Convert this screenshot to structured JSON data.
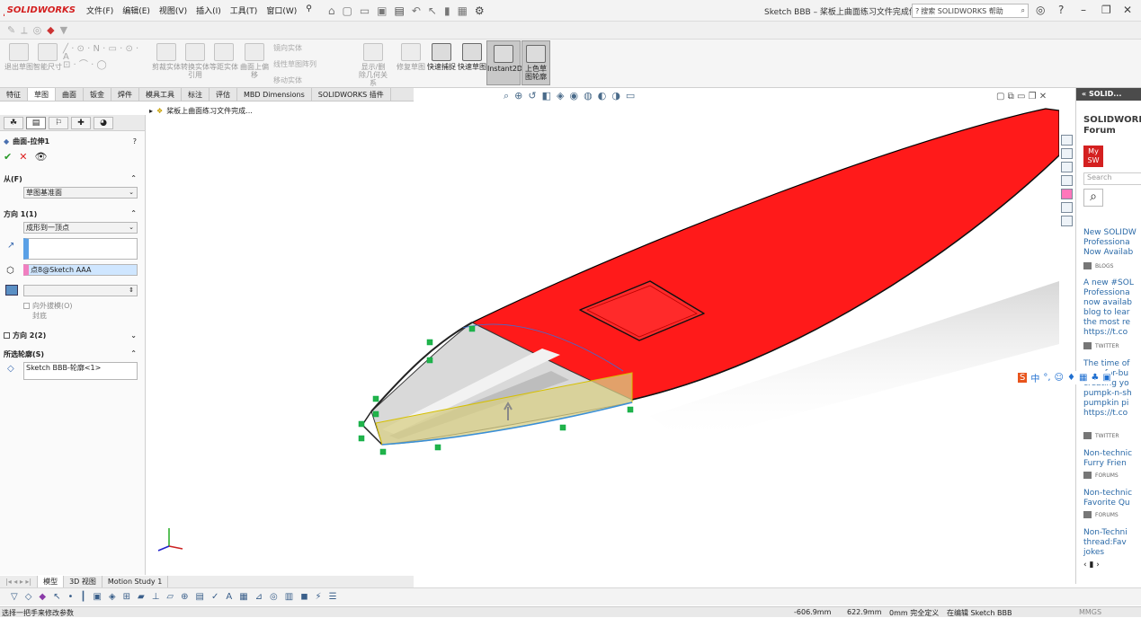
{
  "app": {
    "brand": "SOLIDWORKS",
    "window_title": "Sketch BBB – 桨板上曲面练习文件完成件 *",
    "search_placeholder": "搜索 SOLIDWORKS 帮助"
  },
  "menu": [
    "文件(F)",
    "编辑(E)",
    "视图(V)",
    "插入(I)",
    "工具(T)",
    "窗口(W)"
  ],
  "ribbon": {
    "buttons": [
      {
        "label": "退出草图",
        "active": false
      },
      {
        "label": "智能尺寸",
        "active": false
      },
      {
        "label": "剪裁实体",
        "active": false
      },
      {
        "label": "转换实体引用",
        "active": false
      },
      {
        "label": "等距实体",
        "active": false
      },
      {
        "label": "曲面上偏移",
        "active": false
      },
      {
        "label": "显示/删除几何关系",
        "active": false
      },
      {
        "label": "修复草图",
        "active": false
      },
      {
        "label": "快速捕捉",
        "active": true
      },
      {
        "label": "快速草图",
        "active": true
      },
      {
        "label": "Instant2D",
        "active": true
      },
      {
        "label": "上色草图轮廓",
        "active": true
      }
    ],
    "small": [
      "镜向实体",
      "线性草图阵列",
      "移动实体"
    ]
  },
  "tabs": [
    "特征",
    "草图",
    "曲面",
    "钣金",
    "焊件",
    "模具工具",
    "标注",
    "评估",
    "MBD Dimensions",
    "SOLIDWORKS 插件"
  ],
  "active_tab": "草图",
  "property_manager": {
    "title": "曲面-拉伸1",
    "from_label": "从(F)",
    "from_value": "草图基准面",
    "dir1_label": "方向 1(1)",
    "dir1_value": "成形到一顶点",
    "vertex_value": "点8@Sketch AAA",
    "draft_outward": "向外拔模(O)",
    "cap_end": "封底",
    "dir2_label": "方向 2(2)",
    "contours_label": "所选轮廓(S)",
    "contours_value": "Sketch BBB-轮廓<1>"
  },
  "feature_tree_root": "桨板上曲面练习文件完成...",
  "task_pane": {
    "header": "SOLID...",
    "title": "SOLIDWORKS Forum",
    "my_sw": "My SW",
    "search_placeholder": "Search",
    "items": [
      {
        "lines": [
          "New SOLIDW",
          "Professiona",
          "Now Availab"
        ],
        "tag": "BLOGS"
      },
      {
        "lines": [
          "A new #SOL",
          "Professiona",
          "now availab",
          "blog to lear",
          "the most re",
          "https://t.co"
        ],
        "tag": "TWITTER"
      },
      {
        "lines": [
          "The time of",
          "cozy-for-bu",
          "creating yo",
          "pumpk-n-sh",
          "pumpkin pi",
          "https://t.co"
        ],
        "tag": "TWITTER"
      },
      {
        "lines": [
          "Non-technic",
          "Furry Frien"
        ],
        "tag": "FORUMS"
      },
      {
        "lines": [
          "Non-technic",
          "Favorite Qu"
        ],
        "tag": "FORUMS"
      },
      {
        "lines": [
          "Non-Techni",
          "thread:Fav",
          "jokes"
        ],
        "tag": ""
      }
    ]
  },
  "bottom_tabs": [
    "模型",
    "3D 视图",
    "Motion Study 1"
  ],
  "status": {
    "hint": "选择一把手来修改参数",
    "x": "-606.9mm",
    "y": "622.9mm",
    "z": "0mm 完全定义",
    "editing": "在编辑 Sketch BBB",
    "units": "MMGS"
  },
  "colors": {
    "body_red": "#ff1a1a",
    "accent_blue": "#1f4f8a"
  }
}
